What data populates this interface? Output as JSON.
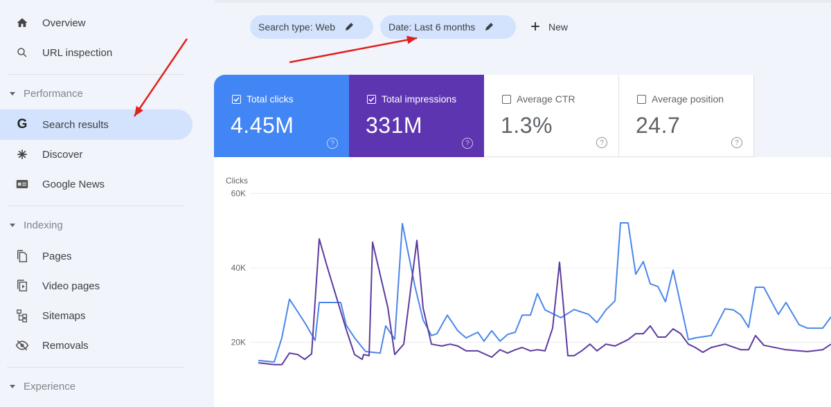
{
  "sidebar": {
    "items_top": [
      {
        "label": "Overview",
        "icon": "home-icon"
      },
      {
        "label": "URL inspection",
        "icon": "search-icon"
      }
    ],
    "sections": [
      {
        "title": "Performance",
        "items": [
          {
            "label": "Search results",
            "icon": "google-g-icon",
            "active": true
          },
          {
            "label": "Discover",
            "icon": "asterisk-icon"
          },
          {
            "label": "Google News",
            "icon": "news-icon"
          }
        ]
      },
      {
        "title": "Indexing",
        "items": [
          {
            "label": "Pages",
            "icon": "pages-icon"
          },
          {
            "label": "Video pages",
            "icon": "video-pages-icon"
          },
          {
            "label": "Sitemaps",
            "icon": "sitemap-icon"
          },
          {
            "label": "Removals",
            "icon": "removals-icon"
          }
        ]
      },
      {
        "title": "Experience",
        "items": []
      }
    ]
  },
  "filters": {
    "chips": [
      {
        "label": "Search type: Web"
      },
      {
        "label": "Date: Last 6 months"
      }
    ],
    "new_label": "New"
  },
  "metrics": [
    {
      "label": "Total clicks",
      "value": "4.45M",
      "checked": true,
      "color": "#4285f4"
    },
    {
      "label": "Total impressions",
      "value": "331M",
      "checked": true,
      "color": "#5e35b1"
    },
    {
      "label": "Average CTR",
      "value": "1.3%",
      "checked": false
    },
    {
      "label": "Average position",
      "value": "24.7",
      "checked": false
    }
  ],
  "help_glyph": "?",
  "chart_data": {
    "type": "line",
    "ylabel": "Clicks",
    "ylim": [
      0,
      60000
    ],
    "yticks": [
      {
        "value": 20000,
        "label": "20K"
      },
      {
        "value": 40000,
        "label": "40K"
      },
      {
        "value": 60000,
        "label": "60K"
      }
    ],
    "grid": true,
    "x_points": 67,
    "series": [
      {
        "name": "Total clicks",
        "color": "#4a86e8",
        "values": [
          15.1,
          14.7,
          21.2,
          31.6,
          25.3,
          20.5,
          30.7,
          30.7,
          24.6,
          21.2,
          17.5,
          17.1,
          24.4,
          20.8,
          51.9,
          35.2,
          26.0,
          21.8,
          22.3,
          27.3,
          23.1,
          21.2,
          22.7,
          20.3,
          23.1,
          20.3,
          22.1,
          22.7,
          27.3,
          27.3,
          33.1,
          28.7,
          26.6,
          28.8,
          27.5,
          25.3,
          28.7,
          31.1,
          52.1,
          52.1,
          38.3,
          41.7,
          35.7,
          35.0,
          30.9,
          39.4,
          20.7,
          21.2,
          21.8,
          29.0,
          28.7,
          27.3,
          24.0,
          34.8,
          34.8,
          27.5,
          30.7,
          24.7,
          23.8,
          23.8,
          26.8
        ],
        "x": [
          373,
          396,
          407,
          418,
          440,
          455,
          461,
          492,
          500,
          512,
          528,
          549,
          557,
          570,
          581,
          599,
          611,
          623,
          631,
          646,
          661,
          673,
          690,
          699,
          710,
          722,
          733,
          744,
          754,
          766,
          776,
          787,
          810,
          829,
          850,
          862,
          875,
          888,
          896,
          907,
          918,
          929,
          939,
          950,
          961,
          972,
          994,
          1004,
          1027,
          1047,
          1059,
          1070,
          1081,
          1091,
          1103,
          1124,
          1135,
          1154,
          1166,
          1188,
          1200
        ]
      },
      {
        "name": "Total impressions",
        "color": "#5b3a9e",
        "values": [
          14.5,
          14.0,
          14.0,
          17.1,
          16.7,
          15.4,
          16.9,
          47.8,
          40.6,
          23.4,
          16.7,
          15.4,
          16.4,
          16.7,
          46.9,
          29.4,
          16.7,
          19.5,
          47.4,
          29.2,
          19.5,
          19.0,
          19.5,
          19.0,
          17.7,
          17.7,
          16.0,
          18.0,
          17.1,
          18.0,
          18.6,
          17.7,
          18.0,
          17.7,
          23.8,
          41.5,
          16.4,
          16.4,
          17.7,
          19.5,
          17.7,
          19.5,
          19.0,
          20.7,
          22.3,
          22.3,
          24.4,
          21.4,
          21.4,
          23.6,
          22.3,
          19.5,
          18.6,
          17.3,
          18.6,
          19.5,
          18.0,
          18.0,
          21.8,
          19.2,
          18.0,
          17.5,
          18.0,
          19.5
        ],
        "x": [
          373,
          396,
          407,
          418,
          430,
          440,
          450,
          461,
          472,
          500,
          512,
          523,
          533,
          525,
          538,
          560,
          570,
          583,
          602,
          611,
          623,
          638,
          650,
          661,
          673,
          690,
          710,
          722,
          733,
          744,
          754,
          766,
          776,
          787,
          798,
          808,
          820,
          829,
          840,
          852,
          862,
          875,
          888,
          907,
          918,
          929,
          939,
          950,
          961,
          972,
          983,
          994,
          1004,
          1015,
          1027,
          1047,
          1070,
          1081,
          1091,
          1103,
          1135,
          1166,
          1188,
          1200
        ]
      }
    ],
    "value_unit": "thousands"
  },
  "annotations": {
    "arrow_color": "#e0201b"
  }
}
